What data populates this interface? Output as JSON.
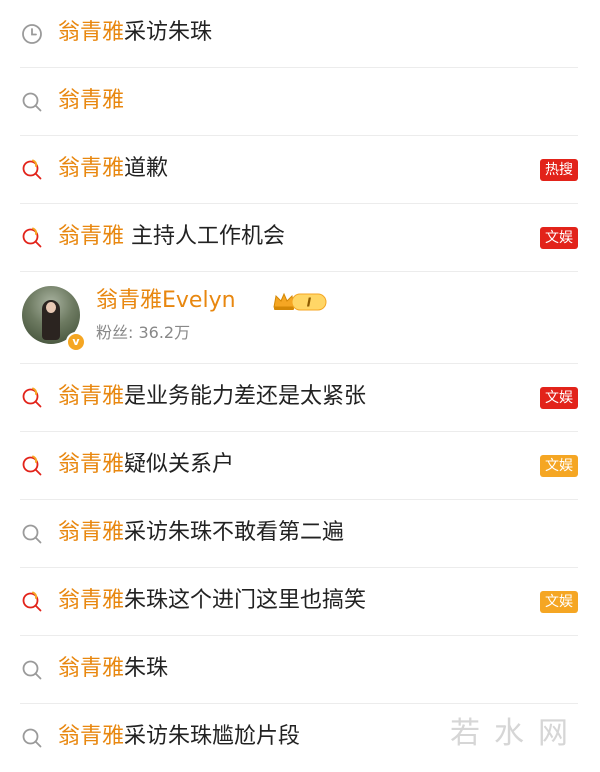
{
  "suggestions": [
    {
      "icon": "history-icon",
      "keyword": "翁青雅",
      "rest": "采访朱珠",
      "badge": null
    },
    {
      "icon": "search-icon",
      "keyword": "翁青雅",
      "rest": "",
      "badge": null
    },
    {
      "icon": "hot-search-icon",
      "keyword": "翁青雅",
      "rest": "道歉",
      "badge": {
        "label": "热搜",
        "color": "#e2231a"
      }
    },
    {
      "icon": "hot-search-icon",
      "keyword": "翁青雅",
      "rest": " 主持人工作机会",
      "badge": {
        "label": "文娱",
        "color": "#e2231a"
      }
    },
    {
      "icon": "hot-search-icon",
      "keyword": "翁青雅",
      "rest": "是业务能力差还是太紧张",
      "badge": {
        "label": "文娱",
        "color": "#e2231a"
      }
    },
    {
      "icon": "hot-search-icon",
      "keyword": "翁青雅",
      "rest": "疑似关系户",
      "badge": {
        "label": "文娱",
        "color": "#f5a623"
      }
    },
    {
      "icon": "search-icon",
      "keyword": "翁青雅",
      "rest": "采访朱珠不敢看第二遍",
      "badge": null
    },
    {
      "icon": "hot-search-icon",
      "keyword": "翁青雅",
      "rest": "朱珠这个进门这里也搞笑",
      "badge": {
        "label": "文娱",
        "color": "#f5a623"
      }
    },
    {
      "icon": "search-icon",
      "keyword": "翁青雅",
      "rest": "朱珠",
      "badge": null
    },
    {
      "icon": "search-icon",
      "keyword": "翁青雅",
      "rest": "采访朱珠尴尬片段",
      "badge": null
    }
  ],
  "user": {
    "name": "翁青雅Evelyn",
    "level_badge": "I",
    "fans": "粉丝: 36.2万",
    "verified_mark": "v"
  },
  "watermark": "若水网",
  "colors": {
    "keyword": "#e8870f",
    "text": "#222222",
    "hot_red": "#e2231a",
    "ent_orange": "#f5a623"
  }
}
